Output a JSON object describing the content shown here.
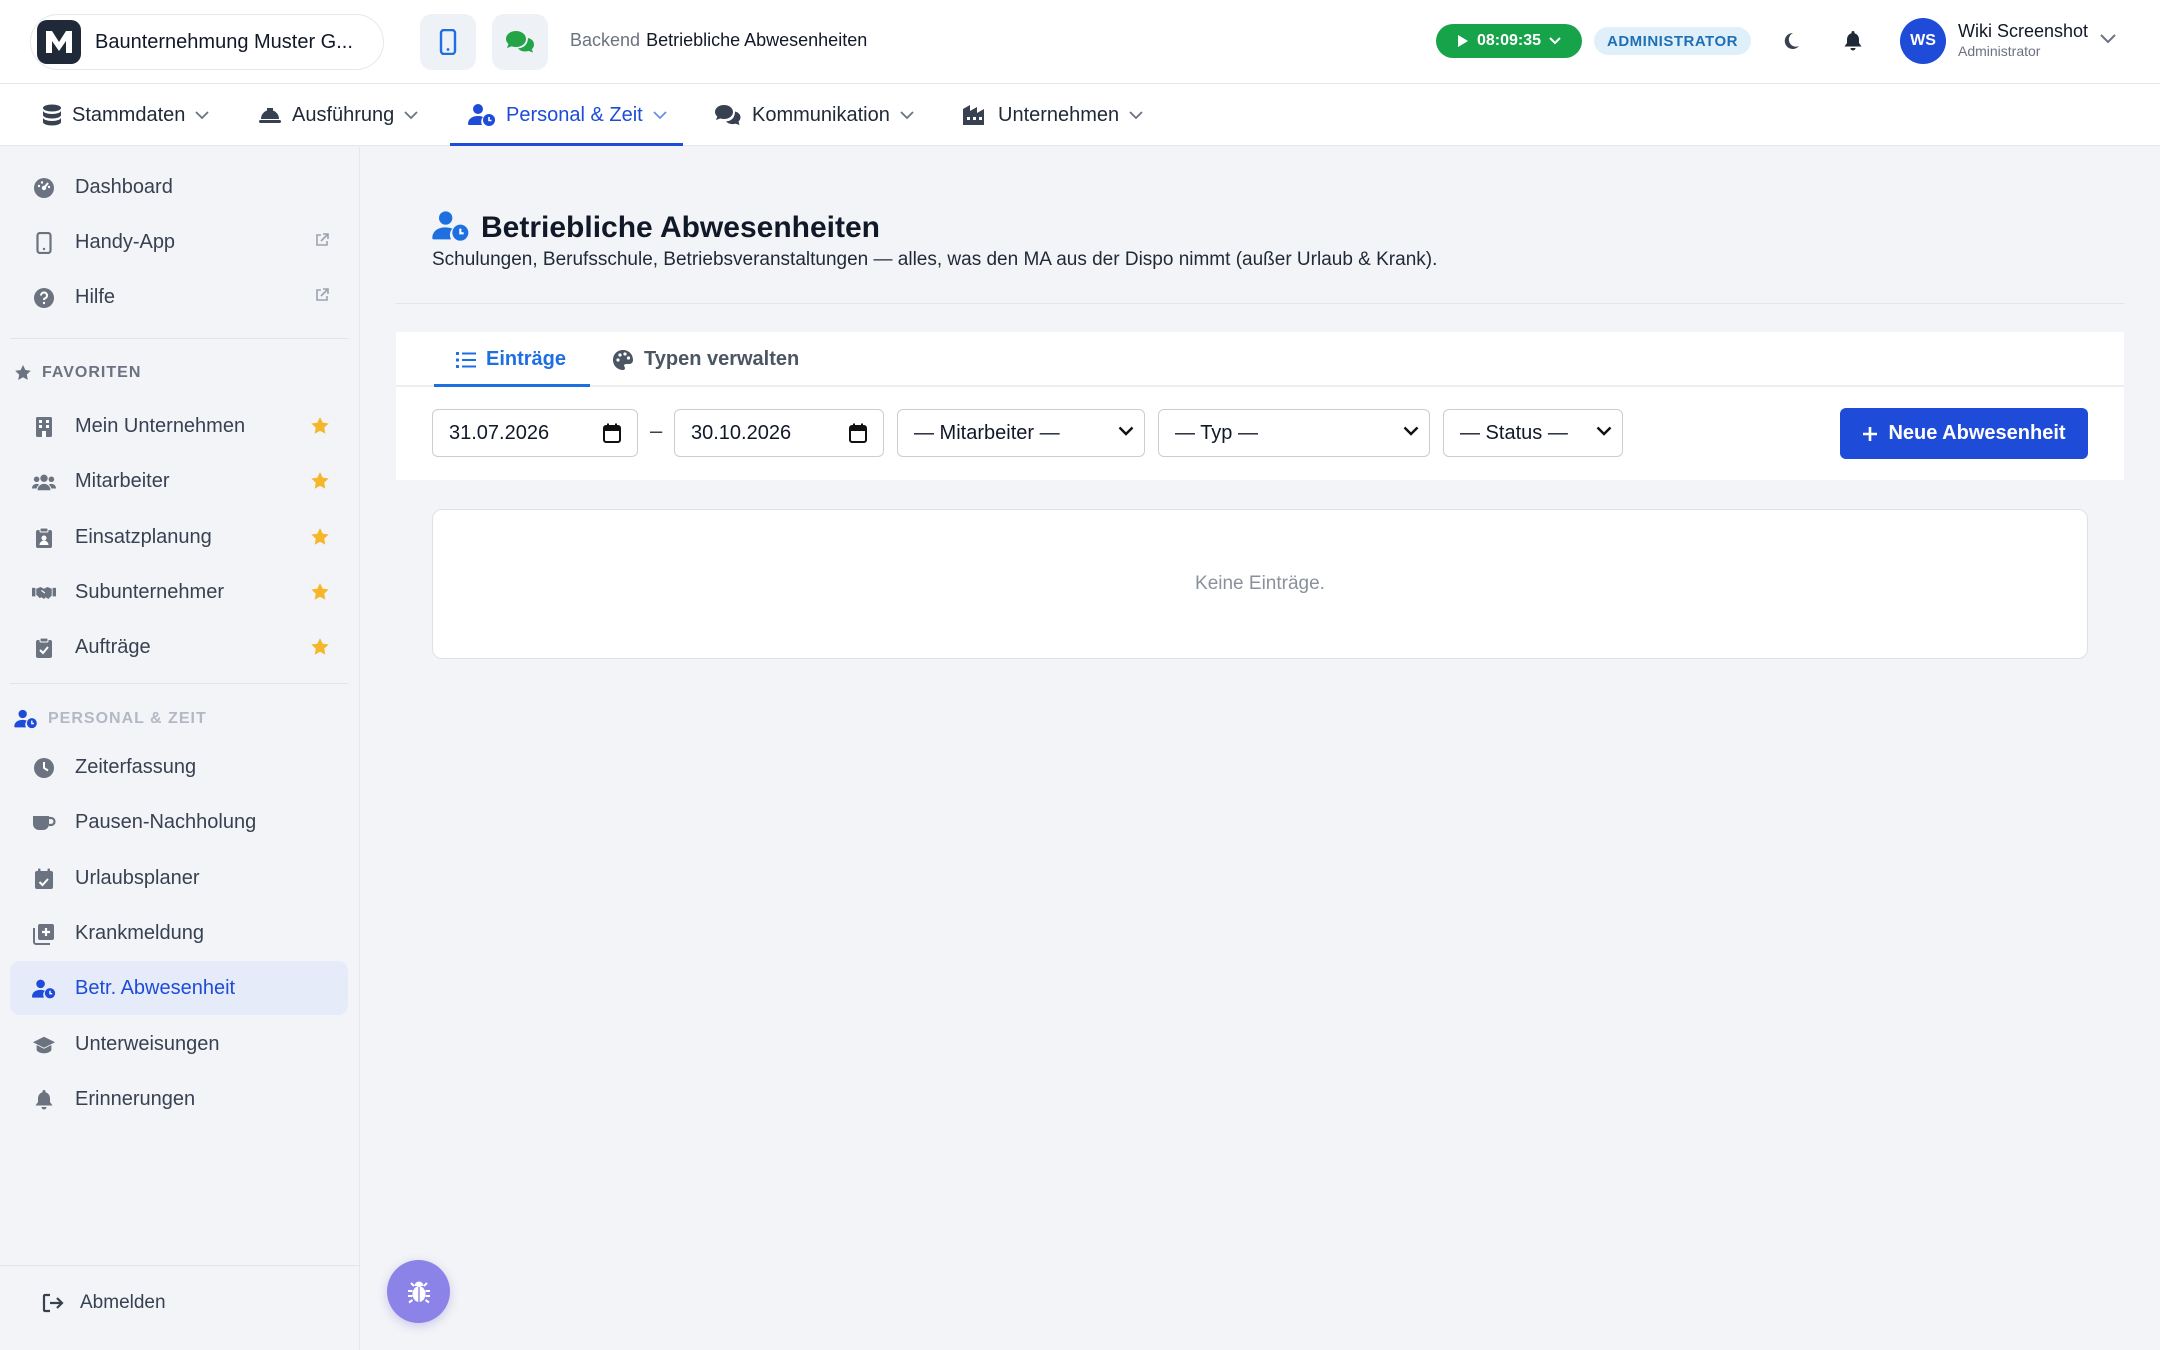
{
  "header": {
    "company_name": "Baunternehmung Muster G...",
    "breadcrumb_root": "Backend",
    "breadcrumb_current": "Betriebliche Abwesenheiten",
    "timer": "08:09:35",
    "role_badge": "ADMINISTRATOR",
    "user_name": "Wiki Screenshot",
    "user_role": "Administrator",
    "avatar_initials": "WS",
    "colors": {
      "timer_bg": "#16a34a",
      "accent": "#1e4bd8",
      "avatar_bg": "#1e4bd8"
    }
  },
  "nav": {
    "items": [
      {
        "label": "Stammdaten",
        "icon": "database-icon"
      },
      {
        "label": "Ausführung",
        "icon": "hard-hat-icon"
      },
      {
        "label": "Personal & Zeit",
        "icon": "user-clock-icon",
        "active": true
      },
      {
        "label": "Kommunikation",
        "icon": "comments-icon"
      },
      {
        "label": "Unternehmen",
        "icon": "building-icon"
      }
    ]
  },
  "sidebar": {
    "top_items": [
      {
        "label": "Dashboard",
        "icon": "gauge-icon"
      },
      {
        "label": "Handy-App",
        "icon": "mobile-icon",
        "external": true
      },
      {
        "label": "Hilfe",
        "icon": "question-icon",
        "external": true
      }
    ],
    "favorites_heading": "FAVORITEN",
    "favorites": [
      {
        "label": "Mein Unternehmen",
        "icon": "building-icon"
      },
      {
        "label": "Mitarbeiter",
        "icon": "users-icon"
      },
      {
        "label": "Einsatzplanung",
        "icon": "clipboard-user-icon"
      },
      {
        "label": "Subunternehmer",
        "icon": "handshake-icon"
      },
      {
        "label": "Aufträge",
        "icon": "clipboard-check-icon"
      }
    ],
    "section_heading": "PERSONAL & ZEIT",
    "section_items": [
      {
        "label": "Zeiterfassung",
        "icon": "clock-icon"
      },
      {
        "label": "Pausen-Nachholung",
        "icon": "coffee-icon"
      },
      {
        "label": "Urlaubsplaner",
        "icon": "calendar-check-icon"
      },
      {
        "label": "Krankmeldung",
        "icon": "medical-note-icon"
      },
      {
        "label": "Betr. Abwesenheit",
        "icon": "user-clock-icon",
        "active": true
      },
      {
        "label": "Unterweisungen",
        "icon": "graduation-cap-icon"
      },
      {
        "label": "Erinnerungen",
        "icon": "bell-icon"
      }
    ],
    "logout_label": "Abmelden"
  },
  "main": {
    "title": "Betriebliche Abwesenheiten",
    "subtitle": "Schulungen, Berufsschule, Betriebsveranstaltungen — alles, was den MA aus der Dispo nimmt (außer Urlaub & Krank).",
    "tabs": [
      {
        "label": "Einträge",
        "icon": "list-icon",
        "active": true
      },
      {
        "label": "Typen verwalten",
        "icon": "palette-icon"
      }
    ],
    "filters": {
      "date_from": "31.07.2026",
      "date_separator": "–",
      "date_to": "30.10.2026",
      "employee": "— Mitarbeiter —",
      "type": "— Typ —",
      "status": "— Status —"
    },
    "new_button": "Neue Abwesenheit",
    "empty_text": "Keine Einträge."
  }
}
